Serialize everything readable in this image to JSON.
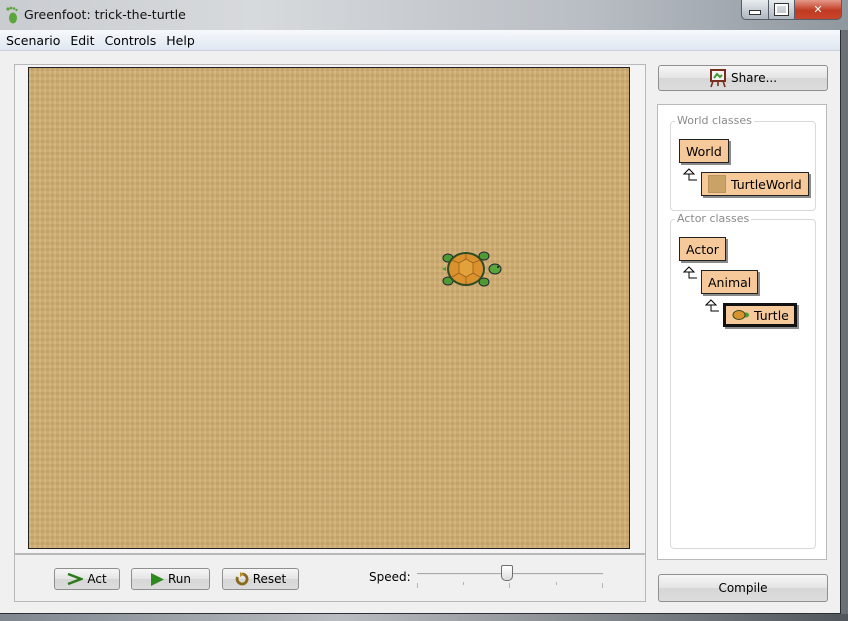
{
  "window": {
    "title": "Greenfoot: trick-the-turtle",
    "app_icon": "greenfoot-footprint-icon",
    "controls": [
      "minimize",
      "maximize",
      "close"
    ]
  },
  "menubar": {
    "items": [
      "Scenario",
      "Edit",
      "Controls",
      "Help"
    ]
  },
  "world": {
    "background": "sand-texture",
    "actors": [
      {
        "class": "Turtle",
        "icon": "turtle-icon"
      }
    ]
  },
  "controls": {
    "act_label": "Act",
    "run_label": "Run",
    "reset_label": "Reset",
    "speed_label": "Speed:",
    "speed_value_percent": 48
  },
  "sidebar": {
    "share_label": "Share...",
    "world_classes_label": "World classes",
    "actor_classes_label": "Actor classes",
    "world_classes": [
      {
        "name": "World"
      },
      {
        "name": "TurtleWorld",
        "parent": "World"
      }
    ],
    "actor_classes": [
      {
        "name": "Actor"
      },
      {
        "name": "Animal",
        "parent": "Actor"
      },
      {
        "name": "Turtle",
        "parent": "Animal",
        "selected": true
      }
    ],
    "compile_label": "Compile"
  },
  "colors": {
    "class_box": "#f5c99a",
    "world_bg": "#d0ad70",
    "close_button": "#c13a22"
  }
}
